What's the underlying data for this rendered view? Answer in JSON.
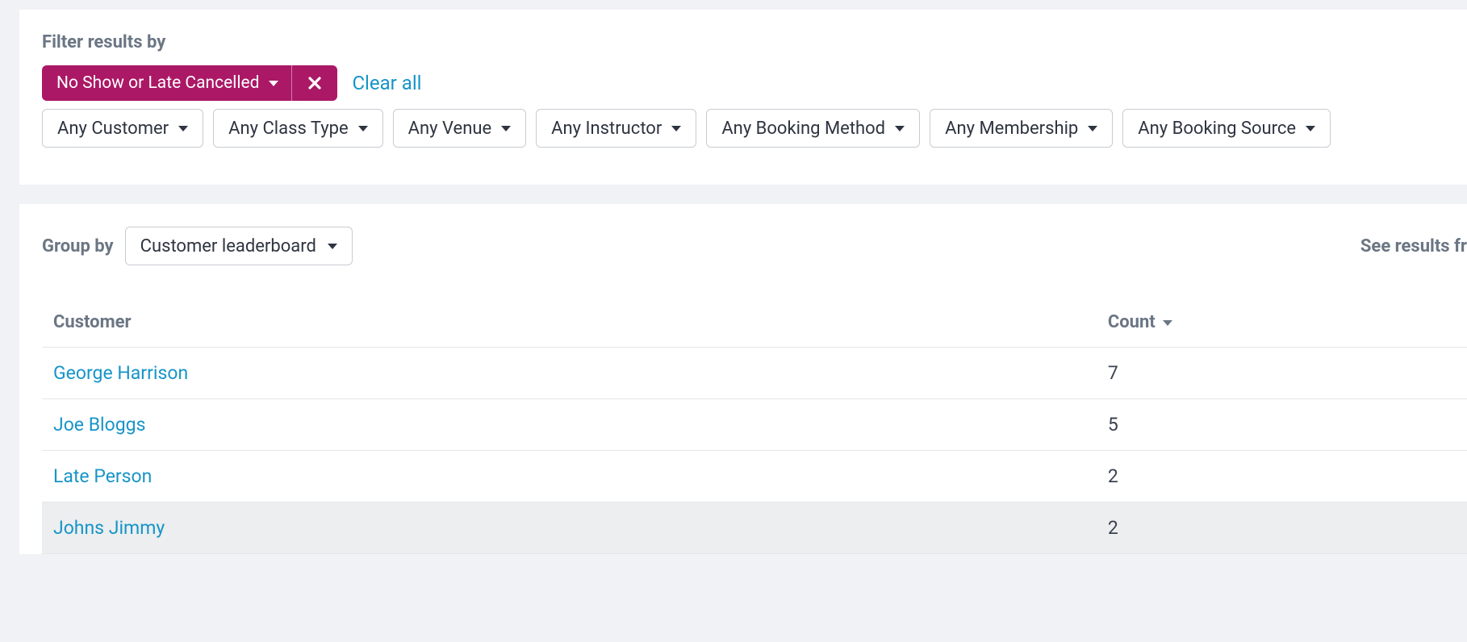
{
  "filters": {
    "heading": "Filter results by",
    "active": {
      "label": "No Show or Late Cancelled"
    },
    "clear_all": "Clear all",
    "dropdowns": [
      "Any Customer",
      "Any Class Type",
      "Any Venue",
      "Any Instructor",
      "Any Booking Method",
      "Any Membership",
      "Any Booking Source"
    ]
  },
  "group_by": {
    "label": "Group by",
    "selected": "Customer leaderboard"
  },
  "see_results": "See results fr",
  "table": {
    "columns": {
      "customer": "Customer",
      "count": "Count"
    },
    "rows": [
      {
        "customer": "George Harrison",
        "count": "7"
      },
      {
        "customer": "Joe Bloggs",
        "count": "5"
      },
      {
        "customer": "Late Person",
        "count": "2"
      },
      {
        "customer": "Johns Jimmy",
        "count": "2"
      }
    ]
  }
}
